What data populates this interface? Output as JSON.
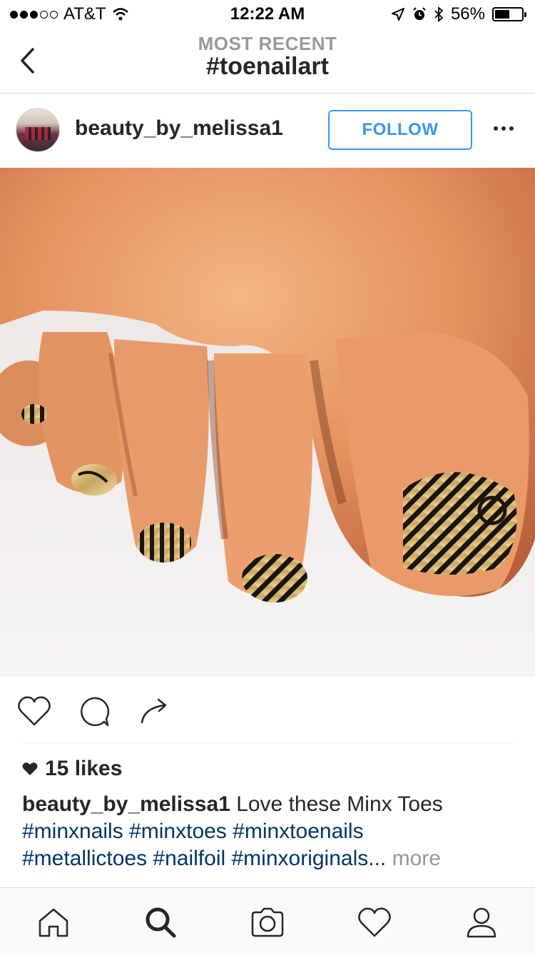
{
  "status_bar": {
    "carrier": "AT&T",
    "time": "12:22 AM",
    "battery": "56%",
    "battery_level": 0.56,
    "signal_bars_filled": 3,
    "signal_bars_total": 5
  },
  "nav": {
    "subtitle": "MOST RECENT",
    "title": "#toenailart",
    "back_icon": "chevron-left-icon"
  },
  "post": {
    "username": "beauty_by_melissa1",
    "follow_label": "FOLLOW",
    "likes": "15 likes",
    "caption_user": "beauty_by_melissa1",
    "caption_text": "Love these Minx Toes",
    "hashtags_line1": [
      "#minxnails",
      "#minxtoes",
      "#minxtoenails"
    ],
    "hashtags_line2": [
      "#metallictoes",
      "#nailfoil",
      "#minxoriginals"
    ],
    "ellipsis": "...",
    "more_label": "more"
  },
  "actions": [
    "heart-icon",
    "comment-icon",
    "share-icon"
  ],
  "tabs": [
    "home-icon",
    "search-icon",
    "camera-icon",
    "heart-icon",
    "profile-icon"
  ],
  "colors": {
    "accent": "#3897f0",
    "hashtag": "#003569",
    "muted": "#999999",
    "text": "#262626"
  }
}
